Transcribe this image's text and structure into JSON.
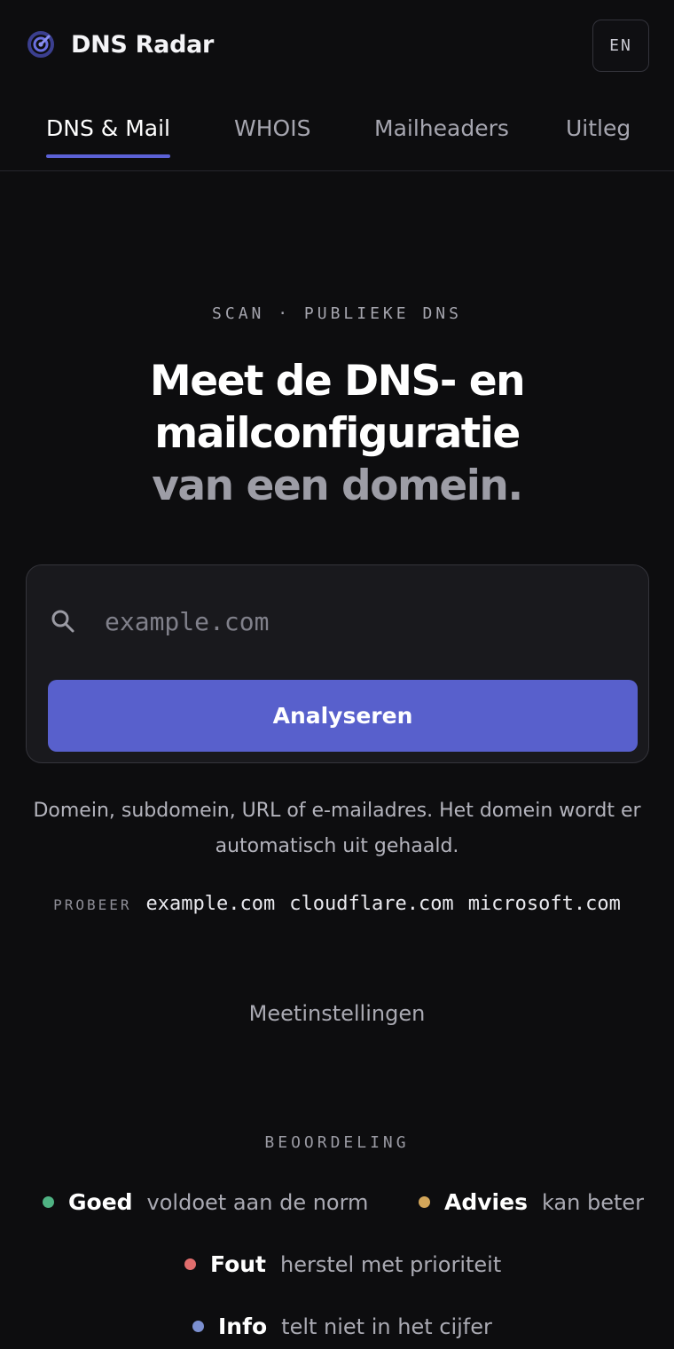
{
  "header": {
    "brand": "DNS Radar",
    "brand_icon": "radar-icon",
    "language_button": "EN"
  },
  "tabs": [
    {
      "label": "DNS & Mail",
      "active": true
    },
    {
      "label": "WHOIS",
      "active": false
    },
    {
      "label": "Mailheaders",
      "active": false
    },
    {
      "label": "Uitleg",
      "active": false
    }
  ],
  "hero": {
    "eyebrow": "SCAN · PUBLIEKE DNS",
    "title_line1": "Meet de DNS- en",
    "title_line2": "mailconfiguratie",
    "title_line3": "van een domein."
  },
  "search": {
    "icon": "search-icon",
    "placeholder": "example.com",
    "value": "",
    "submit_label": "Analyseren"
  },
  "hint": "Domein, subdomein, URL of e-mailadres. Het domein wordt er automatisch uit gehaald.",
  "examples": {
    "label": "PROBEER",
    "items": [
      "example.com",
      "cloudflare.com",
      "microsoft.com"
    ]
  },
  "settings_label": "Meetinstellingen",
  "legend": {
    "title": "BEOORDELING",
    "items": [
      {
        "name": "Goed",
        "description": "voldoet aan de norm",
        "color": "#4fb283"
      },
      {
        "name": "Advies",
        "description": "kan beter",
        "color": "#d3a65a"
      },
      {
        "name": "Fout",
        "description": "herstel met prioriteit",
        "color": "#e06d6d"
      },
      {
        "name": "Info",
        "description": "telt niet in het cijfer",
        "color": "#7b8fd0"
      }
    ]
  },
  "colors": {
    "background": "#0d0d0f",
    "accent": "#5860cc",
    "card": "#19191d"
  }
}
